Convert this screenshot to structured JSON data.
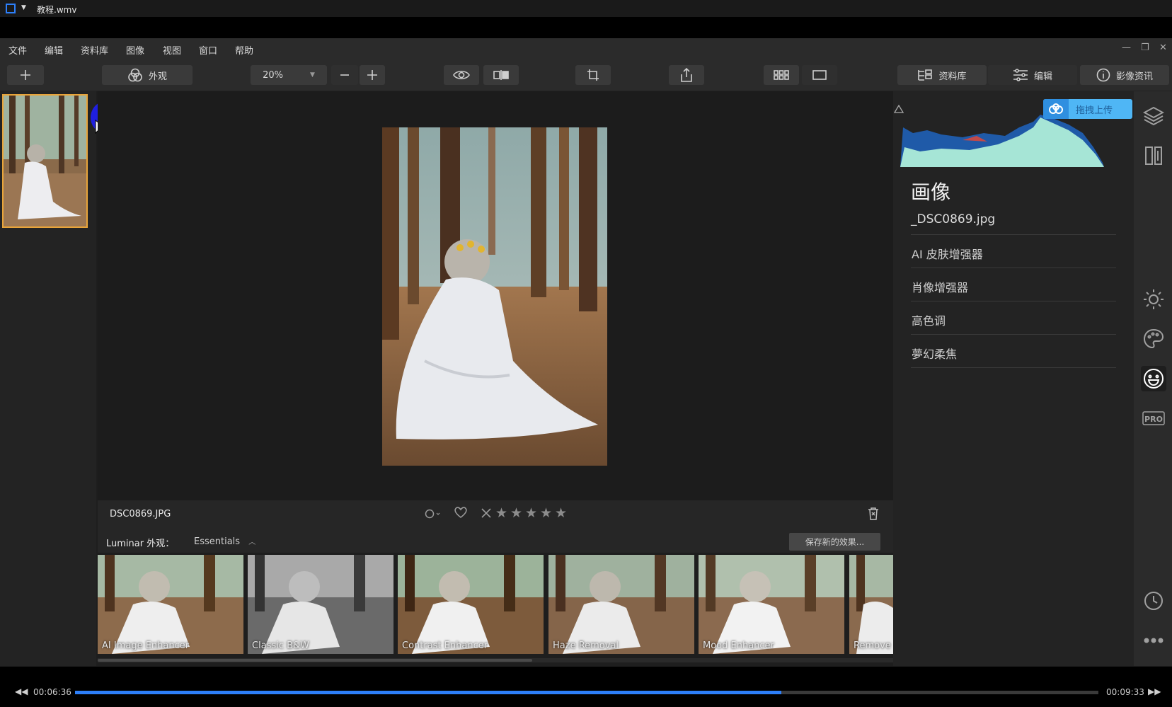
{
  "player": {
    "window_title": "教程.wmv",
    "time_current": "00:06:36",
    "time_total": "00:09:33",
    "progress": 0.69
  },
  "menu": [
    "文件",
    "编辑",
    "资料库",
    "图像",
    "视图",
    "窗口",
    "帮助"
  ],
  "toolbar": {
    "looks_label": "外观",
    "zoom_value": "20%",
    "library_label": "资料库",
    "edit_label": "编辑",
    "info_label": "影像资讯"
  },
  "image": {
    "filename": "DSC0869.JPG"
  },
  "looks": {
    "label": "Luminar 外观：",
    "selected": "Essentials",
    "save_button": "保存新的效果...",
    "items": [
      "AI Image Enhancer",
      "Classic B&W",
      "Contrast Enhancer",
      "Haze Removal",
      "Mood Enhancer",
      "Remove"
    ]
  },
  "panel": {
    "title": "画像",
    "file": "_DSC0869.jpg",
    "items": [
      "AI 皮肤增强器",
      "肖像增强器",
      "高色调",
      "夢幻柔焦"
    ],
    "upload_label": "拖拽上传"
  },
  "icons": {
    "accent": "#2d7ff9",
    "selection": "#e8a43a"
  }
}
